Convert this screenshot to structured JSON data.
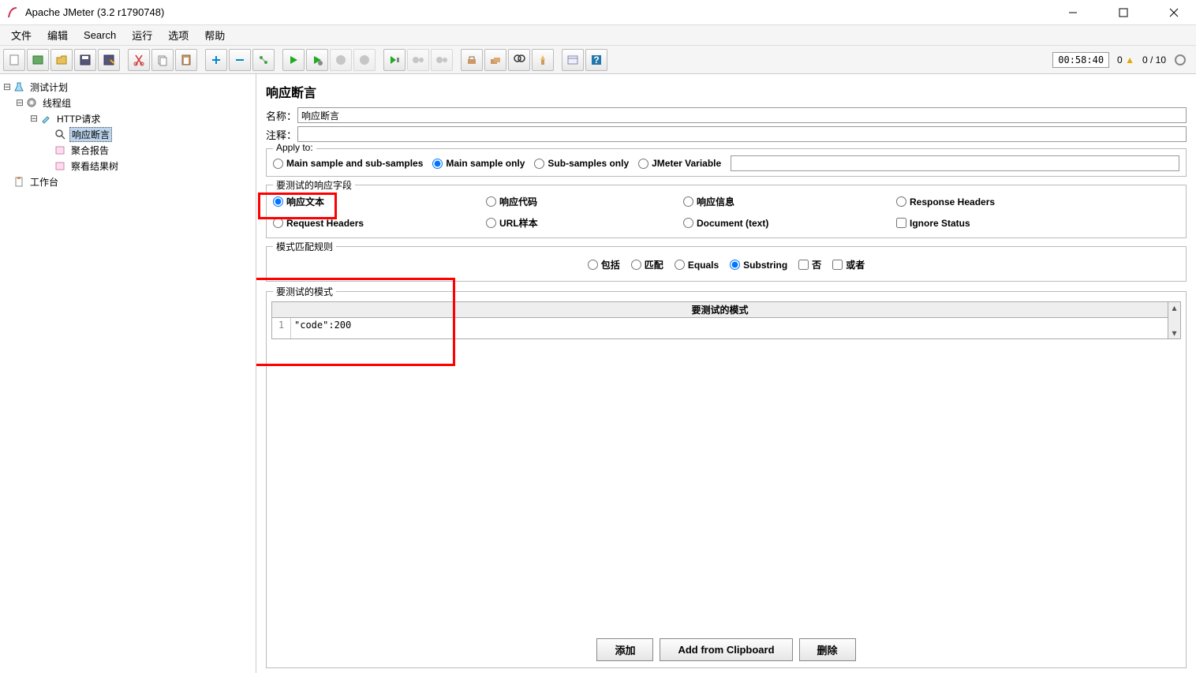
{
  "window": {
    "title": "Apache JMeter (3.2 r1790748)"
  },
  "menu": {
    "file": "文件",
    "edit": "编辑",
    "search": "Search",
    "run": "运行",
    "options": "选项",
    "help": "帮助"
  },
  "status": {
    "time": "00:58:40",
    "count1": "0",
    "threads": "0 / 10"
  },
  "tree": {
    "testplan": "测试计划",
    "threadgroup": "线程组",
    "http": "HTTP请求",
    "assertion": "响应断言",
    "aggregate": "聚合报告",
    "viewtree": "察看结果树",
    "workbench": "工作台"
  },
  "panel": {
    "title": "响应断言",
    "name_label": "名称：",
    "name_value": "响应断言",
    "comment_label": "注释："
  },
  "apply": {
    "legend": "Apply to:",
    "opt1": "Main sample and sub-samples",
    "opt2": "Main sample only",
    "opt3": "Sub-samples only",
    "opt4": "JMeter Variable"
  },
  "field": {
    "legend": "要测试的响应字段",
    "resp_text": "响应文本",
    "resp_code": "响应代码",
    "resp_msg": "响应信息",
    "resp_headers": "Response Headers",
    "req_headers": "Request Headers",
    "url": "URL样本",
    "doc": "Document (text)",
    "ignore": "Ignore Status"
  },
  "match": {
    "legend": "模式匹配规则",
    "contains": "包括",
    "matches": "匹配",
    "equals": "Equals",
    "substring": "Substring",
    "not": "否",
    "or": "或者"
  },
  "patterns": {
    "legend": "要测试的模式",
    "col": "要测试的模式",
    "row1_num": "1",
    "row1_val": "\"code\":200"
  },
  "buttons": {
    "add": "添加",
    "clipboard": "Add from Clipboard",
    "delete": "删除"
  }
}
